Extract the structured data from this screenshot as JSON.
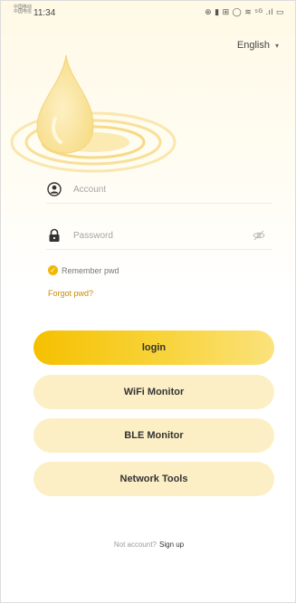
{
  "status_bar": {
    "carrier": "中国移动 中国电信",
    "time": "11:34",
    "icons": "⊕ ▮ ⊞ ◯ ≋ ⁵ᴳ .ıl ▭"
  },
  "language": {
    "selected": "English",
    "caret": "▾"
  },
  "login_form": {
    "account_placeholder": "Account",
    "password_placeholder": "Password",
    "remember_label": "Remember pwd",
    "remember_checked": true,
    "check_mark": "✓",
    "forgot_label": "Forgot pwd?"
  },
  "buttons": {
    "login": "login",
    "wifi_monitor": "WiFi Monitor",
    "ble_monitor": "BLE Monitor",
    "network_tools": "Network Tools"
  },
  "footer": {
    "prompt": "Not account?",
    "signup": "Sign up"
  },
  "icons": {
    "drop": "water-drop-icon",
    "account": "user-icon",
    "password": "lock-icon",
    "visibility": "eye-off-icon"
  },
  "colors": {
    "accent": "#f5c000",
    "accent_light": "#fdefc5",
    "link": "#cc8a00"
  }
}
